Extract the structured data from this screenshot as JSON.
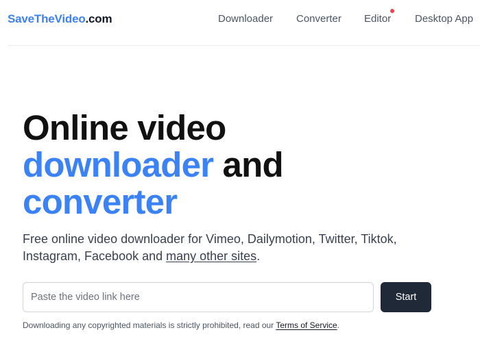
{
  "header": {
    "logo_part1": "SaveTheVideo",
    "logo_part2": ".com",
    "nav": [
      {
        "label": "Downloader"
      },
      {
        "label": "Converter"
      },
      {
        "label": "Editor",
        "has_notification_dot": true
      },
      {
        "label": "Desktop App"
      }
    ]
  },
  "hero": {
    "title_line1": "Online video",
    "title_accent1": "downloader",
    "title_and": " and",
    "title_accent2": "converter",
    "description": "Free online video downloader for Vimeo, Dailymotion, Twitter, Tiktok, Instagram, Facebook and ",
    "description_link": "many other sites",
    "description_end": "."
  },
  "form": {
    "placeholder": "Paste the video link here",
    "value": "",
    "button_label": "Start"
  },
  "disclaimer": {
    "text": "Downloading any copyrighted materials is strictly prohibited, read our ",
    "link": "Terms of Service",
    "end": "."
  },
  "colors": {
    "accent": "#3b82f6",
    "button_bg": "#1f2937",
    "notification_dot": "#ef4444"
  }
}
